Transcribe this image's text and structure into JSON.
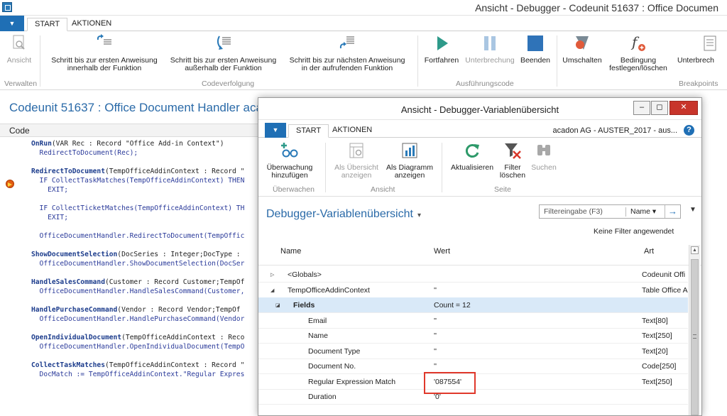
{
  "main": {
    "title": "Ansicht - Debugger - Codeunit 51637 : Office Documen",
    "tabs": [
      "START",
      "AKTIONEN"
    ],
    "ribbon": {
      "buttons": [
        {
          "label1": "Ansicht",
          "label2": ""
        },
        {
          "label1": "Schritt bis zur ersten Anweisung",
          "label2": "innerhalb der Funktion"
        },
        {
          "label1": "Schritt bis zur ersten Anweisung",
          "label2": "außerhalb der Funktion"
        },
        {
          "label1": "Schritt bis zur nächsten Anweisung",
          "label2": "in der aufrufenden Funktion"
        },
        {
          "label1": "Fortfahren",
          "label2": ""
        },
        {
          "label1": "Unterbrechung",
          "label2": ""
        },
        {
          "label1": "Beenden",
          "label2": ""
        },
        {
          "label1": "Umschalten",
          "label2": ""
        },
        {
          "label1": "Bedingung",
          "label2": "festlegen/löschen"
        },
        {
          "label1": "Unterbrech",
          "label2": ""
        }
      ],
      "groups": [
        "Verwalten",
        "Codeverfolgung",
        "Ausführungscode",
        "Breakpoints"
      ]
    },
    "page_title": "Codeunit 51637 : Office Document Handler aca",
    "code_header": "Code",
    "code_lines": [
      {
        "head": "OnRun",
        "rest": "(VAR Rec : Record \"Office Add-in Context\")"
      },
      {
        "head": "",
        "rest": "  RedirectToDocument(Rec);"
      },
      {
        "head": "",
        "rest": ""
      },
      {
        "head": "RedirectToDocument",
        "rest": "(TempOfficeAddinContext : Record \""
      },
      {
        "head": "",
        "rest": "  IF CollectTaskMatches(TempOfficeAddinContext) THEN"
      },
      {
        "head": "",
        "rest": "    EXIT;"
      },
      {
        "head": "",
        "rest": ""
      },
      {
        "head": "",
        "rest": "  IF CollectTicketMatches(TempOfficeAddinContext) TH"
      },
      {
        "head": "",
        "rest": "    EXIT;"
      },
      {
        "head": "",
        "rest": ""
      },
      {
        "head": "",
        "rest": "  OfficeDocumentHandler.RedirectToDocument(TempOffic"
      },
      {
        "head": "",
        "rest": ""
      },
      {
        "head": "ShowDocumentSelection",
        "rest": "(DocSeries : Integer;DocType :"
      },
      {
        "head": "",
        "rest": "  OfficeDocumentHandler.ShowDocumentSelection(DocSer"
      },
      {
        "head": "",
        "rest": ""
      },
      {
        "head": "HandleSalesCommand",
        "rest": "(Customer : Record Customer;TempOf"
      },
      {
        "head": "",
        "rest": "  OfficeDocumentHandler.HandleSalesCommand(Customer,"
      },
      {
        "head": "",
        "rest": ""
      },
      {
        "head": "HandlePurchaseCommand",
        "rest": "(Vendor : Record Vendor;TempOf"
      },
      {
        "head": "",
        "rest": "  OfficeDocumentHandler.HandlePurchaseCommand(Vendor"
      },
      {
        "head": "",
        "rest": ""
      },
      {
        "head": "OpenIndividualDocument",
        "rest": "(TempOfficeAddinContext : Reco"
      },
      {
        "head": "",
        "rest": "  OfficeDocumentHandler.OpenIndividualDocument(TempO"
      },
      {
        "head": "",
        "rest": ""
      },
      {
        "head": "CollectTaskMatches",
        "rest": "(TempOfficeAddinContext : Record \""
      },
      {
        "head": "",
        "rest": "  DocMatch := TempOfficeAddinContext.\"Regular Expres"
      }
    ]
  },
  "varwin": {
    "title": "Ansicht - Debugger-Variablenübersicht",
    "tabs": [
      "START",
      "AKTIONEN"
    ],
    "company": "acadon AG - AUSTER_2017 - aus...",
    "help": "?",
    "buttons": [
      {
        "label1": "Überwachung",
        "label2": "hinzufügen"
      },
      {
        "label1": "Als Übersicht",
        "label2": "anzeigen"
      },
      {
        "label1": "Als Diagramm",
        "label2": "anzeigen"
      },
      {
        "label1": "Aktualisieren",
        "label2": ""
      },
      {
        "label1": "Filter",
        "label2": "löschen"
      },
      {
        "label1": "Suchen",
        "label2": ""
      }
    ],
    "groups": [
      "Überwachen",
      "Ansicht",
      "Seite"
    ],
    "page_title": "Debugger-Variablenübersicht",
    "filter": {
      "placeholder": "Filtereingabe (F3)",
      "field": "Name"
    },
    "no_filter": "Keine Filter angewendet",
    "columns": [
      "Name",
      "Wert",
      "Art"
    ],
    "rows": [
      {
        "name": "<Globals>",
        "value": "",
        "type": "Codeunit Offi"
      },
      {
        "name": "TempOfficeAddinContext",
        "value": "''",
        "type": "Table Office A"
      },
      {
        "name": "Fields",
        "value": "Count = 12",
        "type": ""
      },
      {
        "name": "Email",
        "value": "''",
        "type": "Text[80]"
      },
      {
        "name": "Name",
        "value": "''",
        "type": "Text[250]"
      },
      {
        "name": "Document Type",
        "value": "''",
        "type": "Text[20]"
      },
      {
        "name": "Document No.",
        "value": "''",
        "type": "Code[250]"
      },
      {
        "name": "Regular Expression Match",
        "value": "'087554'",
        "type": "Text[250]"
      },
      {
        "name": "Duration",
        "value": "'0'",
        "type": ""
      }
    ]
  },
  "colors": {
    "accent": "#1f6fb5",
    "title_blue": "#2a6aa8",
    "highlight": "#e0382b",
    "selection": "#d9e9f8"
  }
}
